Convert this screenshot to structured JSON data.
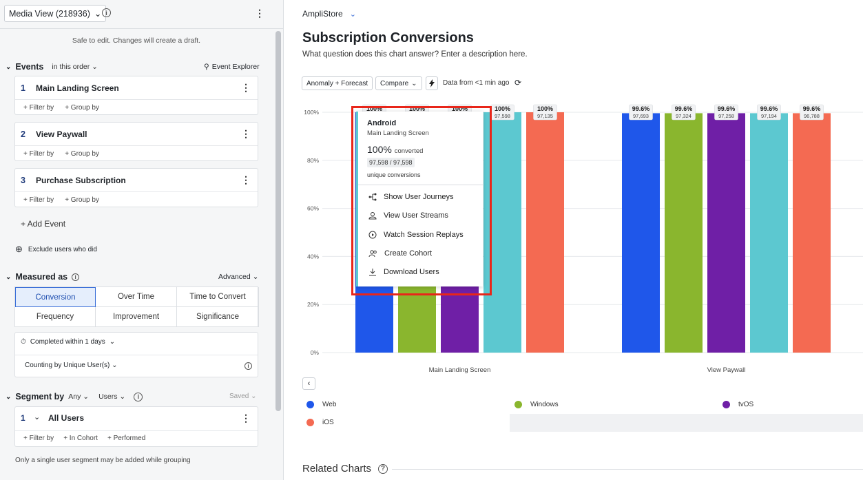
{
  "left": {
    "view_selector": "Media View (218936)",
    "safe_text": "Safe to edit. Changes will create a draft.",
    "events_title": "Events",
    "order_label": "in this order",
    "event_explorer": "Event Explorer",
    "events": [
      {
        "num": "1",
        "name": "Main Landing Screen",
        "filter": "+ Filter by",
        "group": "+ Group by"
      },
      {
        "num": "2",
        "name": "View Paywall",
        "filter": "+ Filter by",
        "group": "+ Group by"
      },
      {
        "num": "3",
        "name": "Purchase Subscription",
        "filter": "+ Filter by",
        "group": "+ Group by"
      }
    ],
    "add_event": "+ Add Event",
    "exclude": "Exclude users who did",
    "measured_as": "Measured as",
    "advanced": "Advanced",
    "measures": [
      "Conversion",
      "Over Time",
      "Time to Convert",
      "Frequency",
      "Improvement",
      "Significance"
    ],
    "completed": "Completed within 1 days",
    "counting": "Counting by Unique User(s)",
    "segment_by": "Segment by",
    "any": "Any",
    "users": "Users",
    "saved": "Saved",
    "segment": {
      "num": "1",
      "name": "All Users",
      "filter": "+ Filter by",
      "cohort": "+ In Cohort",
      "performed": "+ Performed"
    },
    "note": "Only a single user segment may be added while grouping"
  },
  "right": {
    "brand": "AmpliStore",
    "title": "Subscription Conversions",
    "description": "What question does this chart answer? Enter a description here.",
    "anomaly": "Anomaly + Forecast",
    "compare": "Compare",
    "data_from": "Data from <1 min ago",
    "related": "Related Charts"
  },
  "colors": {
    "web": "#1f57ea",
    "windows": "#8ab62e",
    "tvos": "#6f1fa6",
    "android": "#5cc8d0",
    "ios": "#f46a52",
    "accent": "#3b6fd8"
  },
  "chart_data": {
    "type": "bar",
    "categories": [
      "Main Landing Screen",
      "View Paywall"
    ],
    "series": [
      {
        "name": "Web",
        "values": [
          100,
          99.6
        ],
        "labels": [
          "100%",
          "99.6%"
        ],
        "counts": [
          "",
          "97,693"
        ]
      },
      {
        "name": "Windows",
        "values": [
          100,
          99.6
        ],
        "labels": [
          "100%",
          "99.6%"
        ],
        "counts": [
          "",
          "97,324"
        ]
      },
      {
        "name": "tvOS",
        "values": [
          100,
          99.6
        ],
        "labels": [
          "100%",
          "99.6%"
        ],
        "counts": [
          "",
          "97,258"
        ]
      },
      {
        "name": "Android",
        "values": [
          100,
          99.6
        ],
        "labels": [
          "100%",
          "99.6%"
        ],
        "counts": [
          "97,598",
          "97,194"
        ]
      },
      {
        "name": "iOS",
        "values": [
          100,
          99.6
        ],
        "labels": [
          "100%",
          "99.6%"
        ],
        "counts": [
          "97,135",
          "96,788"
        ]
      }
    ],
    "yticks": [
      "0%",
      "20%",
      "40%",
      "60%",
      "80%",
      "100%"
    ],
    "ylim": [
      0,
      100
    ],
    "legend_position": "bottom"
  },
  "tooltip": {
    "title": "Android",
    "step": "Main Landing Screen",
    "percent": "100%",
    "converted": "converted",
    "ratio": "97,598 / 97,598",
    "unique": "unique conversions",
    "menu": [
      "Show User Journeys",
      "View User Streams",
      "Watch Session Replays",
      "Create Cohort",
      "Download Users"
    ]
  }
}
